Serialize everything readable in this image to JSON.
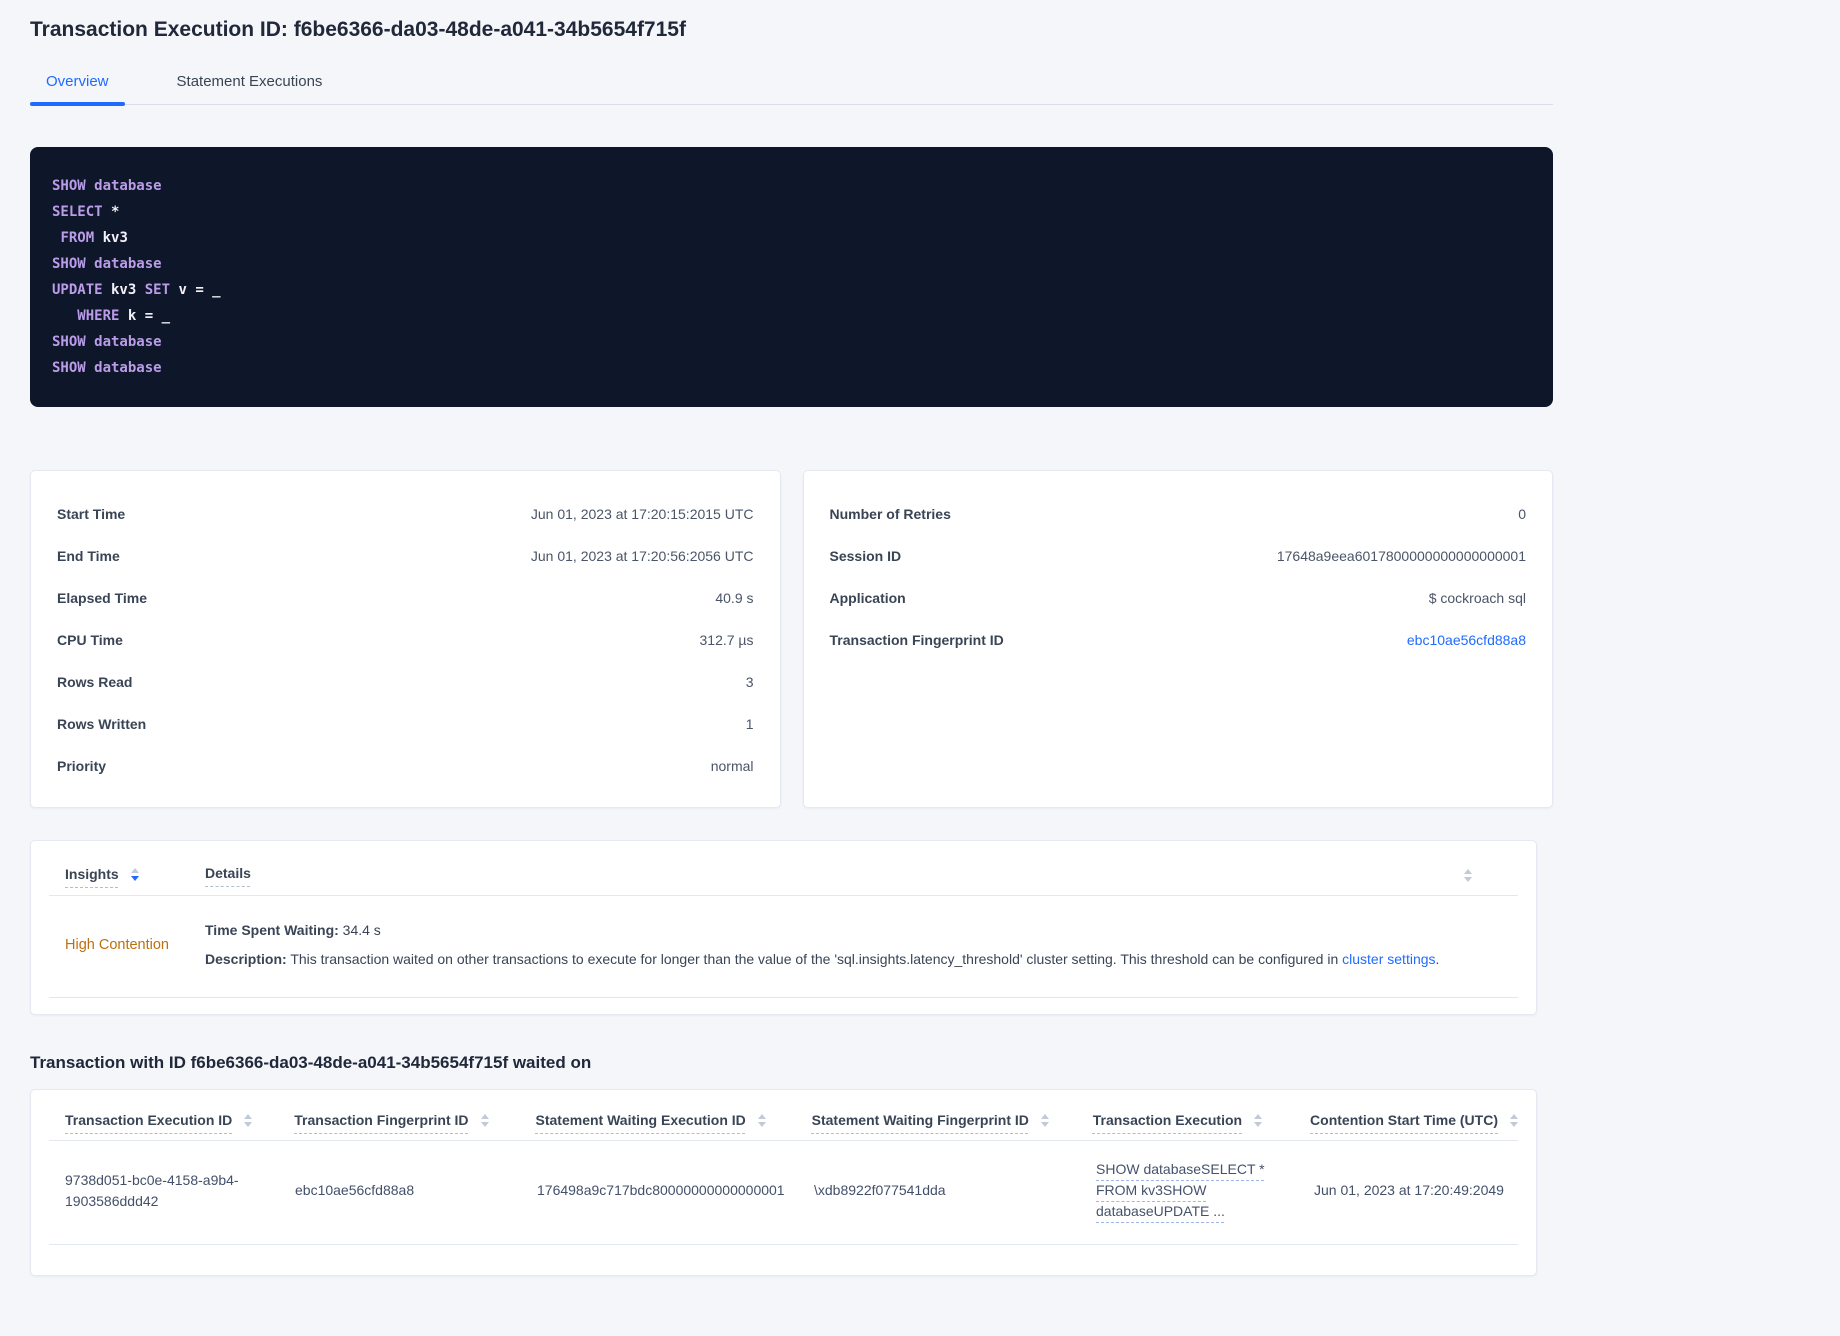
{
  "page": {
    "title": "Transaction Execution ID: f6be6366-da03-48de-a041-34b5654f715f"
  },
  "tabs": {
    "overview": "Overview",
    "statement_executions": "Statement Executions"
  },
  "sql": {
    "lines": [
      {
        "tokens": [
          {
            "text": "SHOW database",
            "cls": "tok-kw"
          }
        ]
      },
      {
        "tokens": [
          {
            "text": "SELECT",
            "cls": "tok-kw"
          },
          {
            "text": " *",
            "cls": "tok-id"
          }
        ]
      },
      {
        "tokens": [
          {
            "text": " ",
            "cls": "tok-id"
          },
          {
            "text": "FROM",
            "cls": "tok-kw"
          },
          {
            "text": " kv3",
            "cls": "tok-id"
          }
        ]
      },
      {
        "tokens": [
          {
            "text": "SHOW database",
            "cls": "tok-kw"
          }
        ]
      },
      {
        "tokens": [
          {
            "text": "UPDATE",
            "cls": "tok-kw"
          },
          {
            "text": " kv3 ",
            "cls": "tok-id"
          },
          {
            "text": "SET",
            "cls": "tok-kw"
          },
          {
            "text": " v = _",
            "cls": "tok-id"
          }
        ]
      },
      {
        "tokens": [
          {
            "text": "   ",
            "cls": "tok-id"
          },
          {
            "text": "WHERE",
            "cls": "tok-kw"
          },
          {
            "text": " k = _",
            "cls": "tok-id"
          }
        ]
      },
      {
        "tokens": [
          {
            "text": "SHOW database",
            "cls": "tok-kw"
          }
        ]
      },
      {
        "tokens": [
          {
            "text": "SHOW database",
            "cls": "tok-kw"
          }
        ]
      }
    ]
  },
  "summary_left": {
    "rows": [
      {
        "label": "Start Time",
        "value": "Jun 01, 2023 at 17:20:15:2015 UTC"
      },
      {
        "label": "End Time",
        "value": "Jun 01, 2023 at 17:20:56:2056 UTC"
      },
      {
        "label": "Elapsed Time",
        "value": "40.9 s"
      },
      {
        "label": "CPU Time",
        "value": "312.7 µs"
      },
      {
        "label": "Rows Read",
        "value": "3"
      },
      {
        "label": "Rows Written",
        "value": "1"
      },
      {
        "label": "Priority",
        "value": "normal"
      }
    ]
  },
  "summary_right": {
    "rows": [
      {
        "label": "Number of Retries",
        "value": "0"
      },
      {
        "label": "Session ID",
        "value": "17648a9eea6017800000000000000001"
      },
      {
        "label": "Application",
        "value": "$ cockroach sql"
      },
      {
        "label": "Transaction Fingerprint ID",
        "value": "ebc10ae56cfd88a8"
      }
    ]
  },
  "insights": {
    "columns": [
      "Insights",
      "Details"
    ],
    "row": {
      "insight": "High Contention",
      "waiting_label": "Time Spent Waiting:",
      "waiting_value": " 34.4 s",
      "description_label": "Description:",
      "description_text": " This transaction waited on other transactions to execute for longer than the value of the 'sql.insights.latency_threshold' cluster setting. This threshold can be configured in ",
      "description_link": "cluster settings",
      "description_suffix": "."
    }
  },
  "waited_on": {
    "heading": "Transaction with ID f6be6366-da03-48de-a041-34b5654f715f waited on",
    "columns": [
      "Transaction Execution ID",
      "Transaction Fingerprint ID",
      "Statement Waiting Execution ID",
      "Statement Waiting Fingerprint ID",
      "Transaction Execution",
      "Contention Start Time (UTC)"
    ],
    "row": {
      "transaction_execution_id": "9738d051-bc0e-4158-a9b4-1903586ddd42",
      "transaction_fingerprint_id": "ebc10ae56cfd88a8",
      "statement_waiting_execution_id": "176498a9c717bdc80000000000000001",
      "statement_waiting_fingerprint_id": "\\xdb8922f077541dda",
      "transaction_execution": "SHOW databaseSELECT * FROM kv3SHOW databaseUPDATE ...",
      "contention_start_time": "Jun 01, 2023 at 17:20:49:2049"
    }
  },
  "colors": {
    "accent": "#1f6bff",
    "insight_warning": "#bf6e0e",
    "sql_keyword": "#bb9ce9",
    "sql_identifier": "#f3f1f8",
    "sql_background": "#0d1729"
  }
}
